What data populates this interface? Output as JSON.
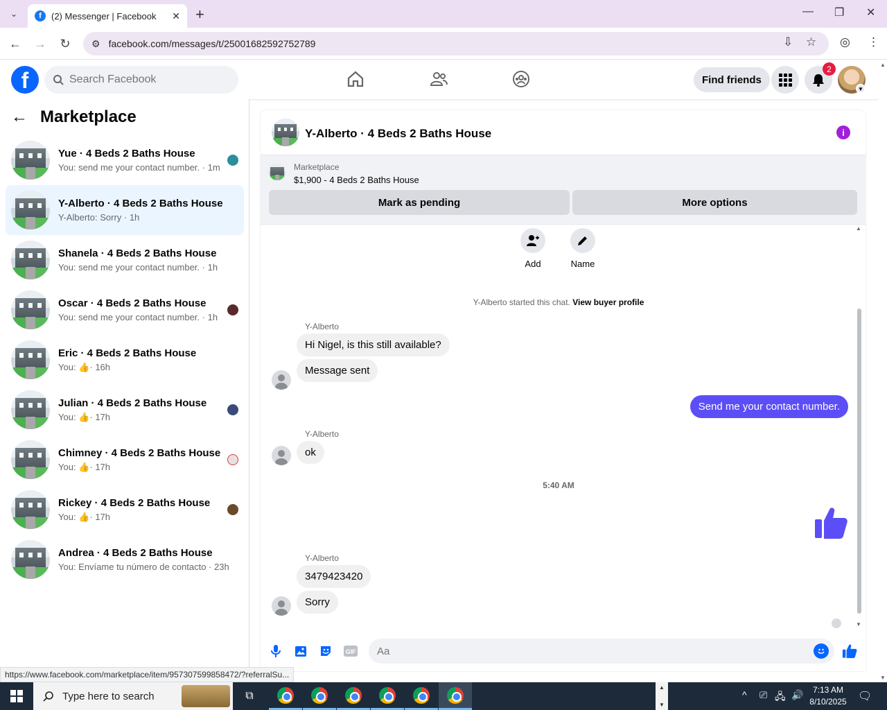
{
  "browser": {
    "tab_title": "(2) Messenger | Facebook",
    "url": "facebook.com/messages/t/25001682592752789",
    "status_url": "https://www.facebook.com/marketplace/item/957307599858472/?referralSu..."
  },
  "fb_header": {
    "search_placeholder": "Search Facebook",
    "find_friends": "Find friends",
    "notification_count": "2"
  },
  "sidebar": {
    "title": "Marketplace",
    "conversations": [
      {
        "name": "Yue · 4 Beds 2 Baths House",
        "preview": "You: send me your contact number. · 1m"
      },
      {
        "name": "Y-Alberto · 4 Beds 2 Baths House",
        "preview": "Y-Alberto: Sorry · 1h"
      },
      {
        "name": "Shanela · 4 Beds 2 Baths House",
        "preview": "You: send me your contact number. · 1h"
      },
      {
        "name": "Oscar · 4 Beds 2 Baths House",
        "preview": "You: send me your contact number. · 1h"
      },
      {
        "name": "Eric · 4 Beds 2 Baths House",
        "preview_prefix": "You:",
        "preview_suffix": "· 16h"
      },
      {
        "name": "Julian · 4 Beds 2 Baths House",
        "preview_prefix": "You:",
        "preview_suffix": "· 17h"
      },
      {
        "name": "Chimney · 4 Beds 2 Baths House",
        "preview_prefix": "You:",
        "preview_suffix": "· 17h"
      },
      {
        "name": "Rickey · 4 Beds 2 Baths House",
        "preview_prefix": "You:",
        "preview_suffix": "· 17h"
      },
      {
        "name": "Andrea · 4 Beds 2 Baths House",
        "preview": "You: Envíame tu número de contacto · 23h"
      }
    ]
  },
  "chat": {
    "title": "Y-Alberto · 4 Beds 2 Baths House",
    "marketplace_label": "Marketplace",
    "listing": "$1,900 - 4 Beds 2 Baths House",
    "mark_pending": "Mark as pending",
    "more_options": "More options",
    "add_label": "Add",
    "name_label": "Name",
    "system_text": "Y-Alberto started this chat.",
    "system_link": "View buyer profile",
    "sender_name": "Y-Alberto",
    "msg1": "Hi Nigel, is this still available?",
    "msg2": "Message sent",
    "msg_out": "Send me your contact number.",
    "msg3": "ok",
    "timestamp": "5:40 AM",
    "msg4": "3479423420",
    "msg5": "Sorry",
    "composer_placeholder": "Aa"
  },
  "taskbar": {
    "search_placeholder": "Type here to search",
    "time": "7:13 AM",
    "date": "8/10/2025"
  },
  "colors": {
    "fb_blue": "#0866ff",
    "outgoing_bubble": "#5b4ef7",
    "active_conv": "#ebf5ff"
  }
}
